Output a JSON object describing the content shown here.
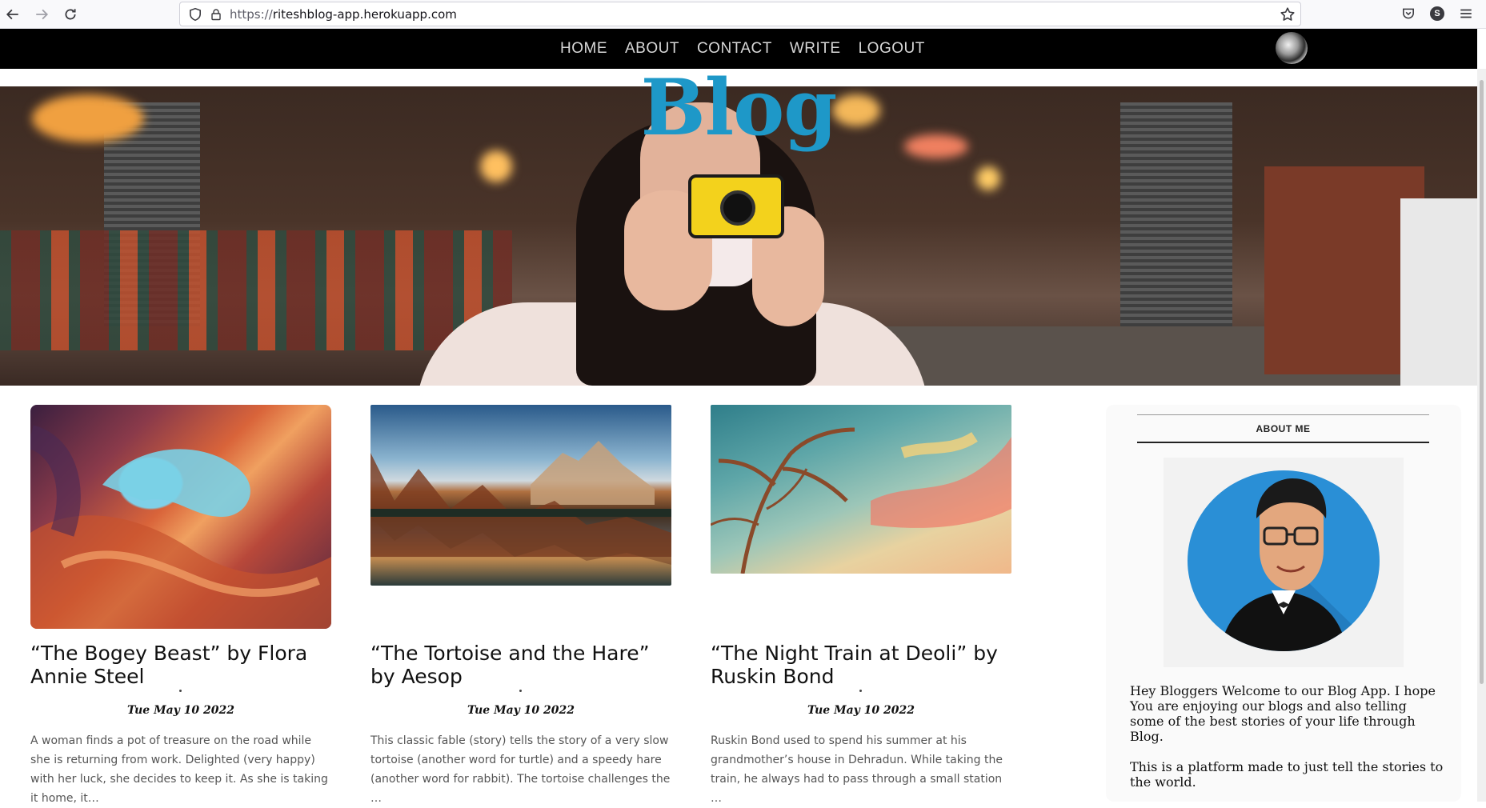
{
  "browser": {
    "url_scheme": "https://",
    "url_host": "riteshblog-app.herokuapp.com",
    "account_initial": "S"
  },
  "site": {
    "nav": [
      "HOME",
      "ABOUT",
      "CONTACT",
      "WRITE",
      "LOGOUT"
    ],
    "hero_title": "Blog"
  },
  "posts": [
    {
      "title": "“The Bogey Beast” by Flora Annie Steel",
      "date": "Tue May 10 2022",
      "excerpt": "A woman finds a pot of treasure on the road while she is returning from work. Delighted (very happy) with her luck, she decides to keep it. As she is taking it home, it…"
    },
    {
      "title": "“The Tortoise and the Hare” by Aesop",
      "date": "Tue May 10 2022",
      "excerpt": "This classic fable (story) tells the story of a very slow tortoise (another word for turtle) and a speedy hare (another word for rabbit). The tortoise challenges the …"
    },
    {
      "title": "“The Night Train at Deoli” by Ruskin Bond",
      "date": "Tue May 10 2022",
      "excerpt": "Ruskin Bond used to spend his summer at his grandmother’s house in Dehradun. While taking the train, he always had to pass through a small station …"
    }
  ],
  "sidebar": {
    "title": "ABOUT ME",
    "paragraphs": [
      "Hey Bloggers Welcome to our Blog App. I hope You are enjoying our blogs and also telling some of the best stories of your life through Blog.",
      "This is a platform made to just tell the stories to the world."
    ]
  },
  "colors": {
    "accent": "#1e98c8",
    "topbar": "#000000"
  },
  "icons": [
    "back-icon",
    "forward-icon",
    "reload-icon",
    "shield-icon",
    "lock-icon",
    "star-icon",
    "pocket-icon",
    "menu-icon"
  ]
}
